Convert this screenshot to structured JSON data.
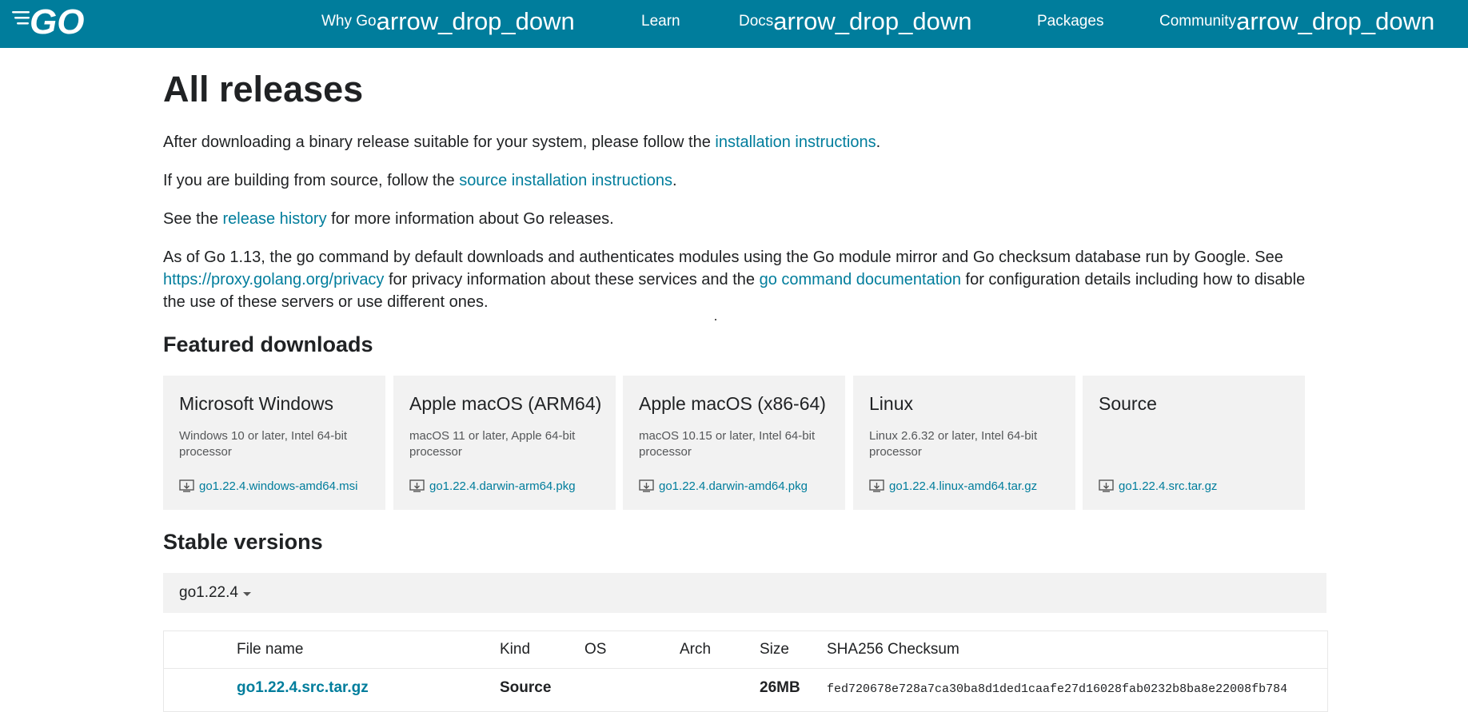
{
  "header": {
    "logo_label": "GO",
    "nav": [
      {
        "label": "Why Go",
        "arrow": "arrow_drop_down"
      },
      {
        "label": "Learn",
        "arrow": ""
      },
      {
        "label": "Docs",
        "arrow": "arrow_drop_down"
      },
      {
        "label": "Packages",
        "arrow": ""
      },
      {
        "label": "Community",
        "arrow": "arrow_drop_down"
      }
    ],
    "background_color": "#007d9c"
  },
  "page": {
    "title": "All releases",
    "p1": {
      "before": "After downloading a binary release suitable for your system, please follow the ",
      "link": "installation instructions",
      "after": "."
    },
    "p2": {
      "before": "If you are building from source, follow the ",
      "link": "source installation instructions",
      "after": "."
    },
    "p3": {
      "before": "See the ",
      "link": "release history",
      "after": " for more information about Go releases."
    },
    "p4": {
      "before": "As of Go 1.13, the go command by default downloads and authenticates modules using the Go module mirror and Go checksum database run by Google. See ",
      "link1": "https://proxy.golang.org/privacy",
      "middle": " for privacy information about these services and the ",
      "link2": "go command documentation",
      "after": " for configuration details including how to disable the use of these servers or use different ones."
    }
  },
  "featured": {
    "heading": "Featured downloads",
    "cards": [
      {
        "title": "Microsoft Windows",
        "desc": "Windows 10 or later, Intel 64-bit processor",
        "file": "go1.22.4.windows-amd64.msi"
      },
      {
        "title": "Apple macOS (ARM64)",
        "desc": "macOS 11 or later, Apple 64-bit processor",
        "file": "go1.22.4.darwin-arm64.pkg"
      },
      {
        "title": "Apple macOS (x86-64)",
        "desc": "macOS 10.15 or later, Intel 64-bit processor",
        "file": "go1.22.4.darwin-amd64.pkg"
      },
      {
        "title": "Linux",
        "desc": "Linux 2.6.32 or later, Intel 64-bit processor",
        "file": "go1.22.4.linux-amd64.tar.gz"
      },
      {
        "title": "Source",
        "desc": "",
        "file": "go1.22.4.src.tar.gz"
      }
    ]
  },
  "stable": {
    "heading": "Stable versions",
    "version": "go1.22.4",
    "columns": [
      "File name",
      "Kind",
      "OS",
      "Arch",
      "Size",
      "SHA256 Checksum"
    ],
    "rows": [
      {
        "file": "go1.22.4.src.tar.gz",
        "kind": "Source",
        "os": "",
        "arch": "",
        "size": "26MB",
        "sha": "fed720678e728a7ca30ba8d1ded1caafe27d16028fab0232b8ba8e22008fb784"
      }
    ]
  }
}
